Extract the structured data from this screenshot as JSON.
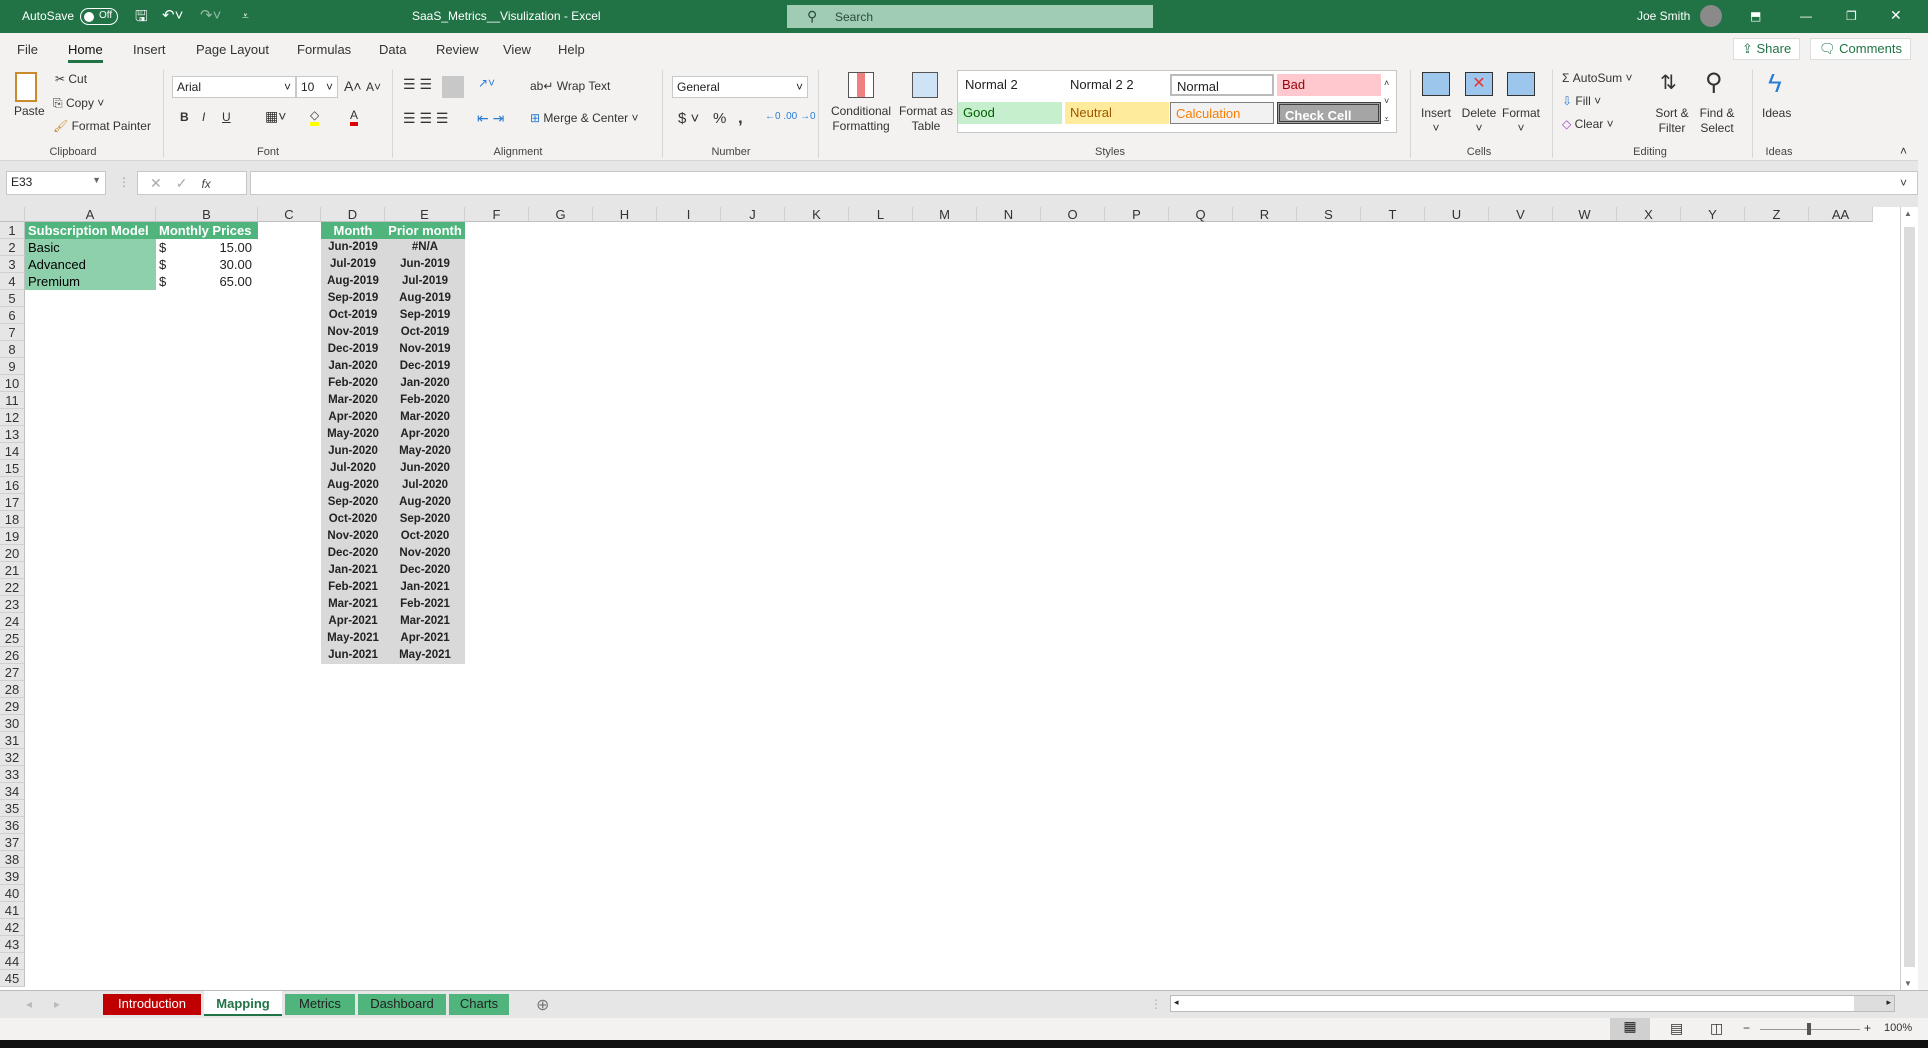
{
  "titlebar": {
    "autosave": "AutoSave",
    "autosave_state": "Off",
    "title": "SaaS_Metrics__Visulization  -  Excel",
    "search_placeholder": "Search",
    "user": "Joe Smith"
  },
  "tabs": [
    "File",
    "Home",
    "Insert",
    "Page Layout",
    "Formulas",
    "Data",
    "Review",
    "View",
    "Help"
  ],
  "share": "Share",
  "comments": "Comments",
  "ribbon": {
    "clipboard": {
      "paste": "Paste",
      "cut": "Cut",
      "copy": "Copy",
      "format_painter": "Format Painter",
      "label": "Clipboard"
    },
    "font": {
      "name": "Arial",
      "size": "10",
      "bold": "B",
      "italic": "I",
      "underline": "U",
      "label": "Font"
    },
    "alignment": {
      "wrap": "Wrap Text",
      "merge": "Merge & Center",
      "label": "Alignment"
    },
    "number": {
      "format": "General",
      "currency": "$",
      "percent": "%",
      "comma": ",",
      "label": "Number"
    },
    "cond_format": "Conditional Formatting",
    "format_table": "Format as Table",
    "styles": {
      "items": [
        "Normal 2",
        "Normal 2 2",
        "Normal",
        "Bad",
        "Good",
        "Neutral",
        "Calculation",
        "Check Cell"
      ],
      "label": "Styles"
    },
    "cells": {
      "insert": "Insert",
      "delete": "Delete",
      "format": "Format",
      "label": "Cells"
    },
    "editing": {
      "autosum": "AutoSum",
      "fill": "Fill",
      "clear": "Clear",
      "sort": "Sort & Filter",
      "find": "Find & Select",
      "label": "Editing"
    },
    "ideas": {
      "button": "Ideas",
      "label": "Ideas"
    }
  },
  "formula_bar": {
    "name_box": "E33",
    "fx": "fx",
    "value": ""
  },
  "columns": [
    "A",
    "B",
    "C",
    "D",
    "E",
    "F",
    "G",
    "H",
    "I",
    "J",
    "K",
    "L",
    "M",
    "N",
    "O",
    "P",
    "Q",
    "R",
    "S",
    "T",
    "U",
    "V",
    "W",
    "X",
    "Y",
    "Z",
    "AA"
  ],
  "sheet": {
    "A1": "Subscription Model",
    "B1": "Monthly Prices",
    "models": [
      {
        "name": "Basic",
        "cur": "$",
        "price": "15.00"
      },
      {
        "name": "Advanced",
        "cur": "$",
        "price": "30.00"
      },
      {
        "name": "Premium",
        "cur": "$",
        "price": "65.00"
      }
    ],
    "D1": "Month",
    "E1": "Prior month",
    "months": [
      "Jun-2019",
      "Jul-2019",
      "Aug-2019",
      "Sep-2019",
      "Oct-2019",
      "Nov-2019",
      "Dec-2019",
      "Jan-2020",
      "Feb-2020",
      "Mar-2020",
      "Apr-2020",
      "May-2020",
      "Jun-2020",
      "Jul-2020",
      "Aug-2020",
      "Sep-2020",
      "Oct-2020",
      "Nov-2020",
      "Dec-2020",
      "Jan-2021",
      "Feb-2021",
      "Mar-2021",
      "Apr-2021",
      "May-2021",
      "Jun-2021"
    ],
    "prior": [
      "#N/A",
      "Jun-2019",
      "Jul-2019",
      "Aug-2019",
      "Sep-2019",
      "Oct-2019",
      "Nov-2019",
      "Dec-2019",
      "Jan-2020",
      "Feb-2020",
      "Mar-2020",
      "Apr-2020",
      "May-2020",
      "Jun-2020",
      "Jul-2020",
      "Aug-2020",
      "Sep-2020",
      "Oct-2020",
      "Nov-2020",
      "Dec-2020",
      "Jan-2021",
      "Feb-2021",
      "Mar-2021",
      "Apr-2021",
      "May-2021"
    ]
  },
  "sheet_tabs": [
    {
      "label": "Introduction",
      "color": "#c00000"
    },
    {
      "label": "Mapping",
      "color": "#ffffff"
    },
    {
      "label": "Metrics",
      "color": "#4fb57d"
    },
    {
      "label": "Dashboard",
      "color": "#4fb57d"
    },
    {
      "label": "Charts",
      "color": "#4fb57d"
    }
  ],
  "status": {
    "zoom": "100%"
  }
}
